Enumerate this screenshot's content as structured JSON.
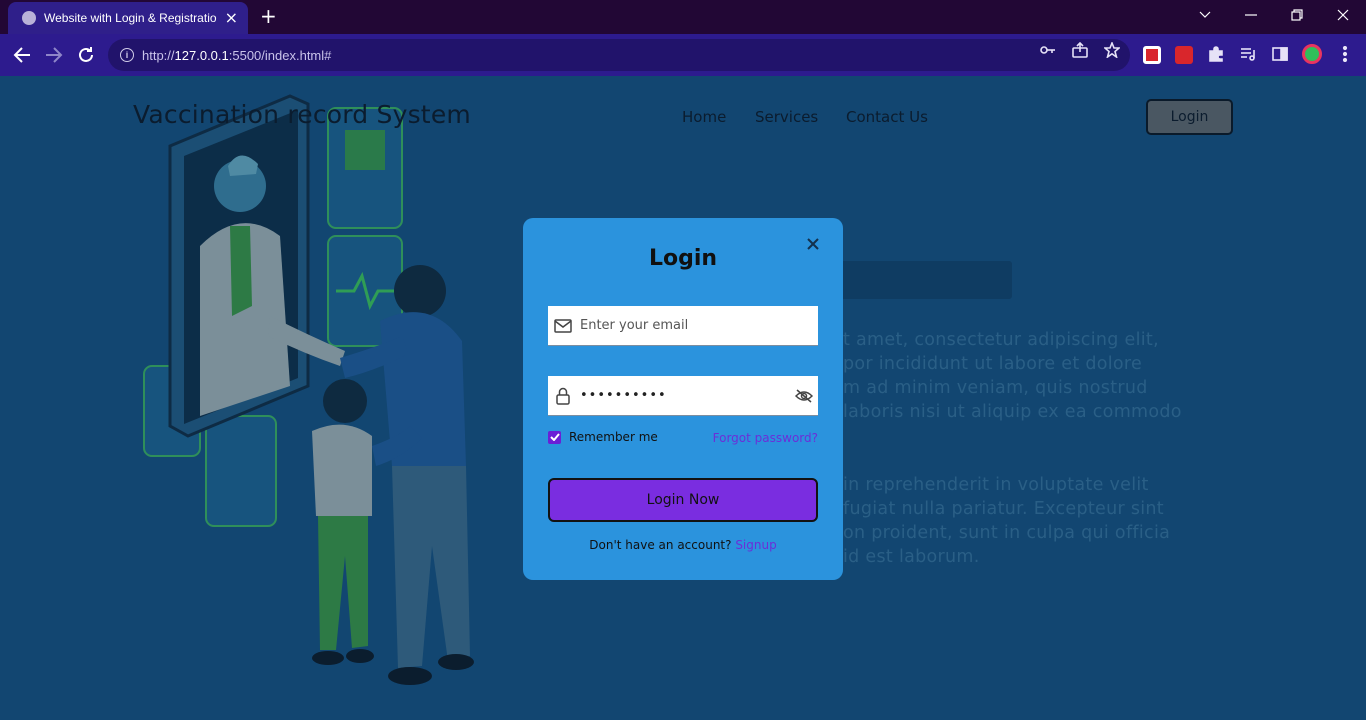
{
  "browser": {
    "tab_title": "Website with Login & Registratio",
    "url_prefix": "http://",
    "url_host": "127.0.0.1",
    "url_rest": ":5500/index.html#",
    "info_glyph": "i",
    "new_tab_glyph": "+",
    "close_glyph": "×"
  },
  "site": {
    "title": "Vaccination record System",
    "nav": [
      "Home",
      "Services",
      "Contact Us"
    ],
    "login_button": "Login"
  },
  "hero": {
    "paragraph1": [
      "t amet, consectetur adipiscing elit,",
      "por incididunt ut labore et dolore",
      "m ad minim veniam, quis nostrud",
      "laboris nisi ut aliquip ex ea commodo"
    ],
    "paragraph2": [
      "in reprehenderit in voluptate velit",
      " fugiat nulla pariatur. Excepteur sint",
      "on proident, sunt in culpa qui officia",
      " id est laborum."
    ]
  },
  "modal": {
    "title": "Login",
    "email_placeholder": "Enter your email",
    "password_value": "••••••••••",
    "remember_label": "Remember me",
    "forgot_link": "Forgot password?",
    "submit_label": "Login Now",
    "signup_prompt": "Don't have an account? ",
    "signup_link": "Signup"
  },
  "colors": {
    "page_bg": "#124671",
    "modal_bg": "#2b93dd",
    "accent": "#7a2de0",
    "browser_toolbar": "#2d1b8e"
  }
}
